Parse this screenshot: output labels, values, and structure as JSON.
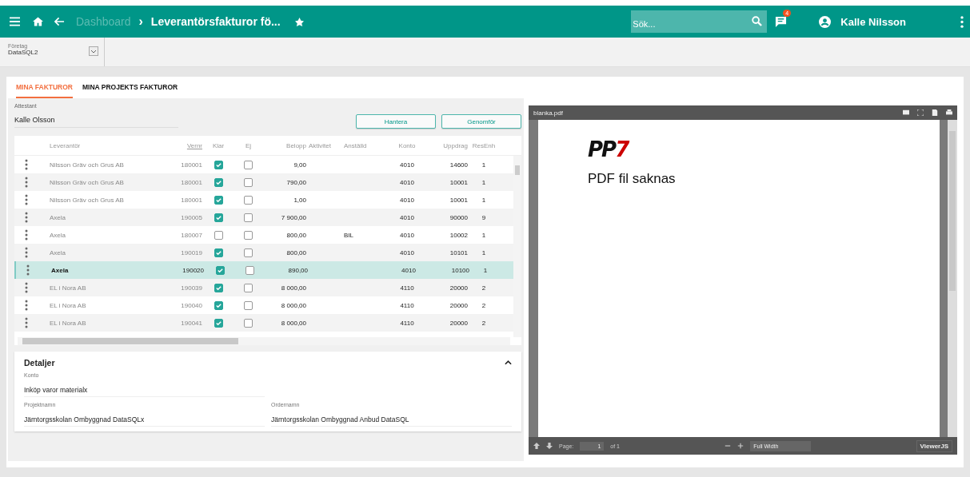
{
  "topbar": {
    "breadcrumb_parent": "Dashboard",
    "separator": "›",
    "title": "Leverantörsfakturor fö...",
    "search": {
      "placeholder": "Sök..."
    },
    "notifications": "4",
    "user": "Kalle Nilsson"
  },
  "company": {
    "label": "Företag",
    "value": "DataSQL2"
  },
  "tabs": [
    {
      "label": "MINA FAKTUROR",
      "selected": true
    },
    {
      "label": "MINA PROJEKTS FAKTUROR",
      "selected": false
    }
  ],
  "attestant": {
    "label": "Attestant",
    "value": "Kalle Olsson"
  },
  "buttons": [
    "Hantera",
    "Genomför"
  ],
  "table": {
    "columns": [
      "Leverantör",
      "Vernr",
      "Klar",
      "Ej",
      "Belopp",
      "Aktivitet",
      "Anställd",
      "Konto",
      "Uppdrag",
      "ResEnh"
    ],
    "rows": [
      {
        "supplier": "Nilsson Gräv och Grus AB",
        "vernr": "180001",
        "klar": true,
        "ej": false,
        "belopp": "9,00",
        "aktivitet": "",
        "anstalld": "",
        "konto": "4010",
        "uppdrag": "14600",
        "resenh": "1",
        "selected": false
      },
      {
        "supplier": "Nilsson Gräv och Grus AB",
        "vernr": "180001",
        "klar": true,
        "ej": false,
        "belopp": "790,00",
        "aktivitet": "",
        "anstalld": "",
        "konto": "4010",
        "uppdrag": "10001",
        "resenh": "1",
        "selected": false
      },
      {
        "supplier": "Nilsson Gräv och Grus AB",
        "vernr": "180001",
        "klar": true,
        "ej": false,
        "belopp": "1,00",
        "aktivitet": "",
        "anstalld": "",
        "konto": "4010",
        "uppdrag": "10001",
        "resenh": "1",
        "selected": false
      },
      {
        "supplier": "Axela",
        "vernr": "190005",
        "klar": true,
        "ej": false,
        "belopp": "7 900,00",
        "aktivitet": "",
        "anstalld": "",
        "konto": "4010",
        "uppdrag": "90000",
        "resenh": "9",
        "selected": false
      },
      {
        "supplier": "Axela",
        "vernr": "180007",
        "klar": false,
        "ej": false,
        "belopp": "800,00",
        "aktivitet": "",
        "anstalld": "BIL",
        "konto": "4010",
        "uppdrag": "10002",
        "resenh": "1",
        "selected": false
      },
      {
        "supplier": "Axela",
        "vernr": "190019",
        "klar": true,
        "ej": false,
        "belopp": "800,00",
        "aktivitet": "",
        "anstalld": "",
        "konto": "4010",
        "uppdrag": "10101",
        "resenh": "1",
        "selected": false
      },
      {
        "supplier": "Axela",
        "vernr": "190020",
        "klar": true,
        "ej": false,
        "belopp": "890,00",
        "aktivitet": "",
        "anstalld": "",
        "konto": "4010",
        "uppdrag": "10100",
        "resenh": "1",
        "selected": true
      },
      {
        "supplier": "EL i Nora AB",
        "vernr": "190039",
        "klar": true,
        "ej": false,
        "belopp": "8 000,00",
        "aktivitet": "",
        "anstalld": "",
        "konto": "4110",
        "uppdrag": "20000",
        "resenh": "2",
        "selected": false
      },
      {
        "supplier": "EL i Nora AB",
        "vernr": "190040",
        "klar": true,
        "ej": false,
        "belopp": "8 000,00",
        "aktivitet": "",
        "anstalld": "",
        "konto": "4110",
        "uppdrag": "20000",
        "resenh": "2",
        "selected": false
      },
      {
        "supplier": "EL i Nora AB",
        "vernr": "190041",
        "klar": true,
        "ej": false,
        "belopp": "8 000,00",
        "aktivitet": "",
        "anstalld": "",
        "konto": "4110",
        "uppdrag": "20000",
        "resenh": "2",
        "selected": false
      }
    ]
  },
  "details": {
    "title": "Detaljer",
    "expanded": true,
    "fields": [
      {
        "label": "Konto",
        "value": "Inköp varor materialx"
      },
      {
        "label": "Projektnamn",
        "value": "Järntorgsskolan Ombyggnad DataSQLx"
      },
      {
        "label": "Ordernamn",
        "value": "Järntorgsskolan Ombyggnad Anbud DataSQL"
      }
    ]
  },
  "viewer": {
    "filename": "blanka.pdf",
    "logo": {
      "text": "PP",
      "accent": "7"
    },
    "message": "PDF fil saknas",
    "page_label": "Page:",
    "page": "1",
    "page_total": "of 1",
    "zoom": "Full Width",
    "brand": "ViewerJS"
  }
}
